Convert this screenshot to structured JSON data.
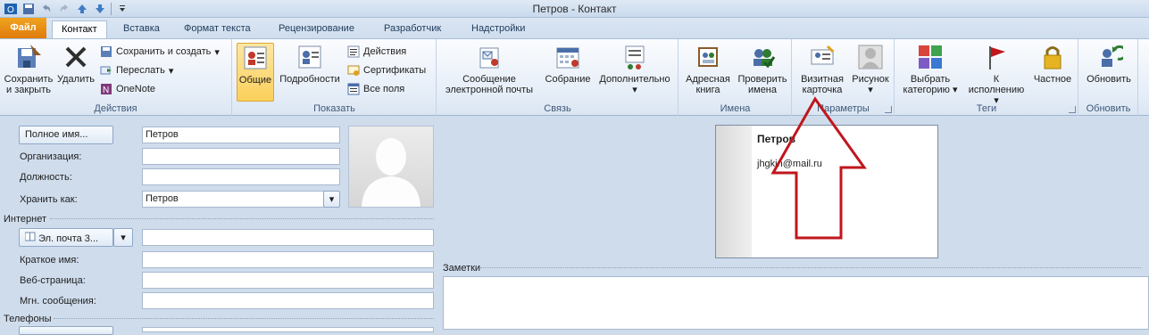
{
  "window": {
    "title": "Петров - Контакт"
  },
  "tabs": [
    "Файл",
    "Контакт",
    "Вставка",
    "Формат текста",
    "Рецензирование",
    "Разработчик",
    "Надстройки"
  ],
  "ribbon": {
    "actions": {
      "label": "Действия",
      "save_close": [
        "Сохранить",
        "и закрыть"
      ],
      "delete": "Удалить",
      "save_new": "Сохранить и создать",
      "forward": "Переслать",
      "onenote": "OneNote"
    },
    "show": {
      "label": "Показать",
      "general": "Общие",
      "details": "Подробности",
      "activities": "Действия",
      "certificates": "Сертификаты",
      "all_fields": "Все поля"
    },
    "communicate": {
      "label": "Связь",
      "email": [
        "Сообщение",
        "электронной почты"
      ],
      "meeting": "Собрание",
      "more": "Дополнительно"
    },
    "names": {
      "label": "Имена",
      "address_book": [
        "Адресная",
        "книга"
      ],
      "check_names": [
        "Проверить",
        "имена"
      ]
    },
    "options": {
      "label": "Параметры",
      "business_card": [
        "Визитная",
        "карточка"
      ],
      "picture": "Рисунок"
    },
    "tags": {
      "label": "Теги",
      "categorize": [
        "Выбрать",
        "категорию"
      ],
      "follow_up": [
        "К",
        "исполнению"
      ],
      "private": "Частное"
    },
    "update": {
      "label": "Обновить",
      "update": "Обновить"
    }
  },
  "form": {
    "full_name_button": "Полное имя...",
    "full_name_value": "Петров",
    "company_label": "Организация:",
    "company_value": "",
    "job_title_label": "Должность:",
    "job_title_value": "",
    "file_as_label": "Хранить как:",
    "file_as_value": "Петров",
    "internet_section": "Интернет",
    "email_button": "Эл. почта 3...",
    "email_value": "",
    "display_as_label": "Краткое имя:",
    "display_as_value": "",
    "web_page_label": "Веб-страница:",
    "web_page_value": "",
    "im_label": "Мгн. сообщения:",
    "im_value": "",
    "phones_section": "Телефоны"
  },
  "business_card": {
    "name": "Петров",
    "email": "jhgkjn@mail.ru"
  },
  "notes": {
    "label": "Заметки",
    "value": ""
  },
  "colors": {
    "accent": "#e07b0c",
    "arrow": "#c0161c"
  }
}
